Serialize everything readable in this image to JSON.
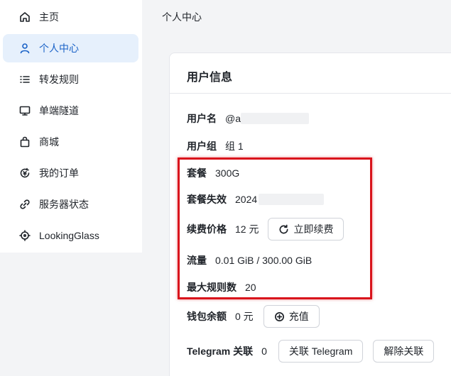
{
  "sidebar": {
    "items": [
      {
        "label": "主页",
        "icon": "home-icon"
      },
      {
        "label": "个人中心",
        "icon": "user-icon",
        "active": true
      },
      {
        "label": "转发规则",
        "icon": "list-icon"
      },
      {
        "label": "单端隧道",
        "icon": "monitor-icon"
      },
      {
        "label": "商城",
        "icon": "shopping-bag-icon"
      },
      {
        "label": "我的订单",
        "icon": "order-refresh-icon"
      },
      {
        "label": "服务器状态",
        "icon": "link-icon"
      },
      {
        "label": "LookingGlass",
        "icon": "crosshair-icon"
      }
    ]
  },
  "header": {
    "breadcrumb": "个人中心"
  },
  "card": {
    "title": "用户信息",
    "username_label": "用户名",
    "username_value": "@a",
    "group_label": "用户组",
    "group_value": "组 1",
    "plan_label": "套餐",
    "plan_value": "300G",
    "expire_label": "套餐失效",
    "expire_value": "2024",
    "renew_label": "续费价格",
    "renew_value": "12 元",
    "renew_button": "立即续费",
    "traffic_label": "流量",
    "traffic_value": "0.01 GiB / 300.00 GiB",
    "max_rules_label": "最大规则数",
    "max_rules_value": "20",
    "wallet_label": "钱包余额",
    "wallet_value": "0 元",
    "recharge_button": "充值",
    "telegram_label": "Telegram 关联",
    "telegram_value": "0",
    "telegram_bind_button": "关联 Telegram",
    "telegram_unbind_button": "解除关联"
  },
  "colors": {
    "accent": "#1a62c7",
    "active_bg": "#e6f0fc",
    "highlight": "#d9141c"
  }
}
